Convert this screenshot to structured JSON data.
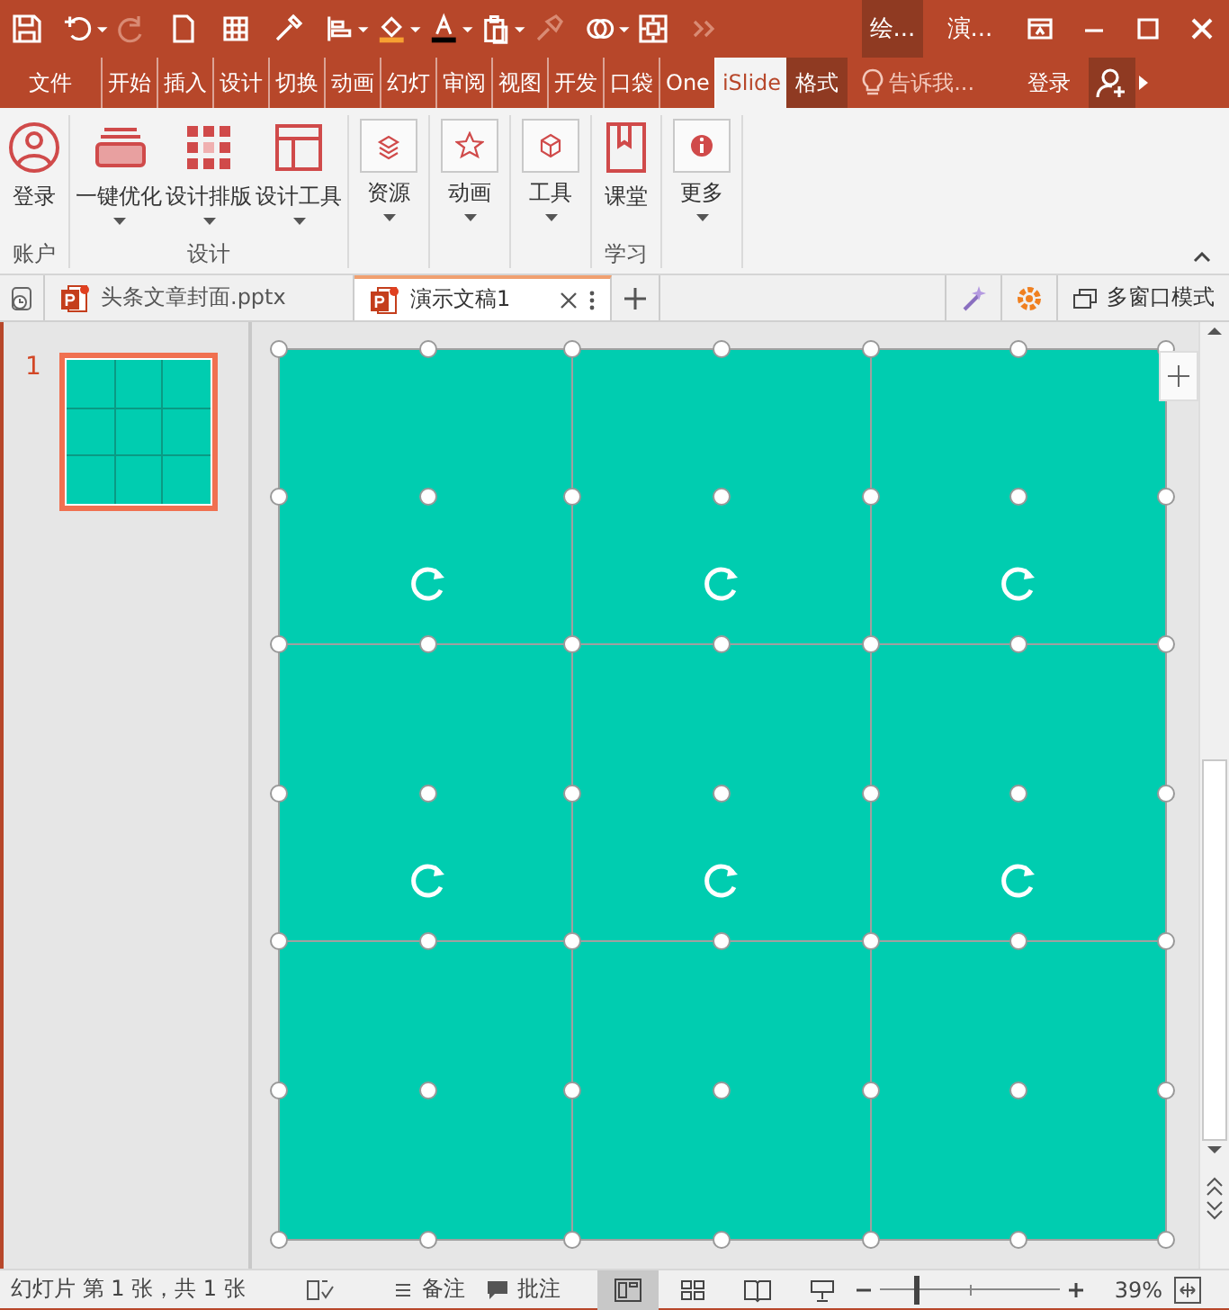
{
  "title_bar": {
    "context_label": "绘...",
    "title": "演..."
  },
  "ribbon_tabs": [
    {
      "label": "文件",
      "selected": false
    },
    {
      "label": "开始",
      "selected": false
    },
    {
      "label": "插入",
      "selected": false
    },
    {
      "label": "设计",
      "selected": false
    },
    {
      "label": "切换",
      "selected": false
    },
    {
      "label": "动画",
      "selected": false
    },
    {
      "label": "幻灯",
      "selected": false
    },
    {
      "label": "审阅",
      "selected": false
    },
    {
      "label": "视图",
      "selected": false
    },
    {
      "label": "开发",
      "selected": false
    },
    {
      "label": "口袋",
      "selected": false
    },
    {
      "label": "One",
      "selected": false
    },
    {
      "label": "iSlide",
      "selected": true
    },
    {
      "label": "格式",
      "selected": false
    }
  ],
  "tell_me": {
    "placeholder": "告诉我..."
  },
  "sign_in": "登录",
  "ribbon_groups": [
    {
      "label": "账户",
      "buttons": [
        {
          "label": "登录",
          "kind": "large",
          "dropdown": false
        }
      ]
    },
    {
      "label": "设计",
      "buttons": [
        {
          "label": "一键优化",
          "kind": "large",
          "dropdown": true
        },
        {
          "label": "设计排版",
          "kind": "large",
          "dropdown": true
        },
        {
          "label": "设计工具",
          "kind": "large",
          "dropdown": true
        }
      ]
    },
    {
      "buttons": [
        {
          "label": "资源",
          "kind": "boxed",
          "dropdown": true
        }
      ]
    },
    {
      "buttons": [
        {
          "label": "动画",
          "kind": "boxed",
          "dropdown": true
        }
      ]
    },
    {
      "buttons": [
        {
          "label": "工具",
          "kind": "boxed",
          "dropdown": true
        }
      ]
    },
    {
      "label": "学习",
      "buttons": [
        {
          "label": "课堂",
          "kind": "large",
          "dropdown": false
        }
      ]
    },
    {
      "buttons": [
        {
          "label": "更多",
          "kind": "boxed",
          "dropdown": true
        }
      ]
    }
  ],
  "doc_tabs": [
    {
      "label": "头条文章封面.pptx",
      "selected": false
    },
    {
      "label": "演示文稿1",
      "selected": true
    }
  ],
  "multi_window": "多窗口模式",
  "thumbnails": [
    {
      "number": "1",
      "selected": true
    }
  ],
  "slide": {
    "shapes_selected": true
  },
  "status_bar": {
    "slide_info": "幻灯片 第 1 张，共 1 张",
    "notes": "备注",
    "comments": "批注",
    "views": [
      {
        "selected": true
      },
      {
        "selected": false
      },
      {
        "selected": false
      },
      {
        "selected": false
      }
    ],
    "zoom_slider": {
      "level": 0.2
    },
    "zoom": "39%"
  }
}
